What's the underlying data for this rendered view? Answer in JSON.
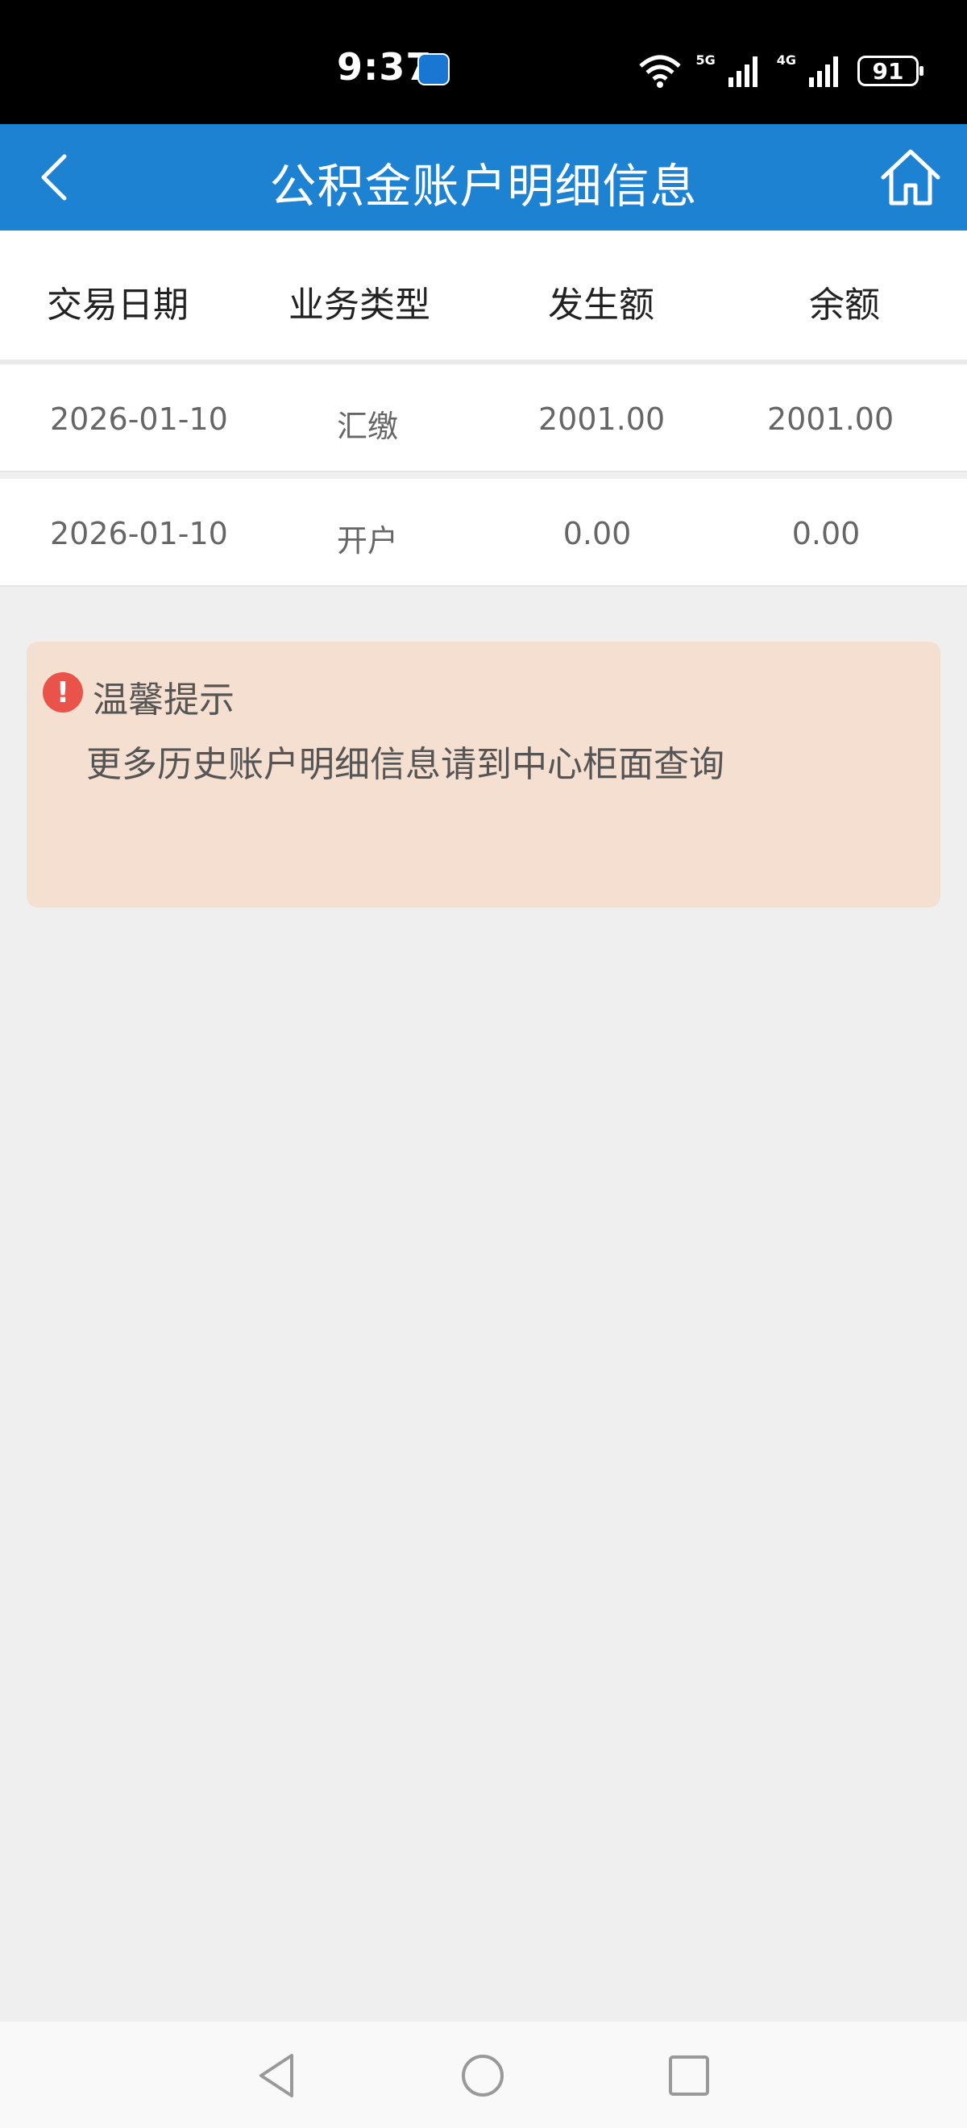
{
  "status_bar": {
    "time": "9:37",
    "network_1": "5G",
    "network_2": "4G",
    "battery": "91"
  },
  "header": {
    "title": "公积金账户明细信息"
  },
  "table": {
    "columns": [
      "交易日期",
      "业务类型",
      "发生额",
      "余额"
    ],
    "rows": [
      {
        "date": "2026-01-10",
        "type": "汇缴",
        "amount": "2001.00",
        "balance": "2001.00"
      },
      {
        "date": "2026-01-10",
        "type": "开户",
        "amount": "0.00",
        "balance": "0.00"
      }
    ]
  },
  "tip": {
    "title": "温馨提示",
    "message": "更多历史账户明细信息请到中心柜面查询"
  },
  "colors": {
    "header_bg": "#1e82d3",
    "tip_bg": "#f5dfd0",
    "tip_icon": "#e9534a"
  },
  "icons": {
    "back": "chevron-left-icon",
    "home": "home-icon",
    "tip": "exclamation-circle-icon"
  }
}
